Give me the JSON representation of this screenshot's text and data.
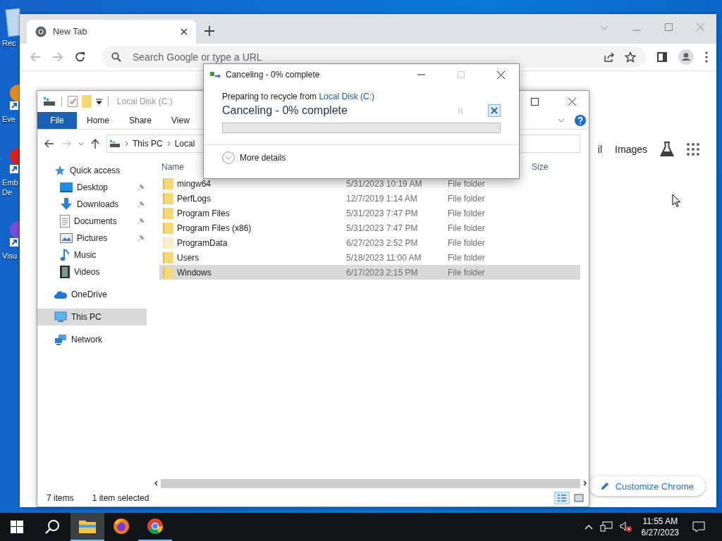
{
  "desktop_icons": [
    {
      "kind": "recycle",
      "lines": [
        "Rec"
      ]
    },
    {
      "kind": "shortcut",
      "lines": [
        "Eve"
      ]
    },
    {
      "kind": "shortcut",
      "lines": [
        "Emb",
        "De"
      ]
    },
    {
      "kind": "shortcut",
      "lines": [
        "Visu"
      ]
    }
  ],
  "browser": {
    "tabs": [
      {
        "title": "New Tab",
        "selected": true
      }
    ],
    "omnibox": {
      "placeholder": "Search Google or type a URL"
    },
    "links": [
      "il",
      "Images"
    ],
    "customize_button": "Customize Chrome"
  },
  "explorer": {
    "title": "Local Disk (C:)",
    "ribbon_tabs": [
      {
        "label": "File",
        "kind": "file"
      },
      {
        "label": "Home",
        "kind": "tab"
      },
      {
        "label": "Share",
        "kind": "tab"
      },
      {
        "label": "View",
        "kind": "tab"
      }
    ],
    "breadcrumb": [
      "This PC",
      "Local"
    ],
    "nav": [
      {
        "label": "Quick access",
        "kind": "star",
        "selected": false,
        "children": [
          {
            "label": "Desktop",
            "kind": "desktop",
            "selected": false,
            "pinned": true
          },
          {
            "label": "Downloads",
            "kind": "downloads",
            "selected": false,
            "pinned": true
          },
          {
            "label": "Documents",
            "kind": "documents",
            "selected": false,
            "pinned": true
          },
          {
            "label": "Pictures",
            "kind": "pictures",
            "selected": false,
            "pinned": true
          },
          {
            "label": "Music",
            "kind": "music",
            "selected": false,
            "pinned": false
          },
          {
            "label": "Videos",
            "kind": "videos",
            "selected": false,
            "pinned": false
          }
        ]
      },
      {
        "label": "OneDrive",
        "kind": "cloud",
        "selected": false
      },
      {
        "label": "This PC",
        "kind": "pc",
        "selected": true
      },
      {
        "label": "Network",
        "kind": "network",
        "selected": false
      }
    ],
    "columns": [
      "Name",
      "Size"
    ],
    "rows": [
      {
        "name": "mingw64",
        "modified": "5/31/2023 10:19 AM",
        "type": "File folder",
        "hidden": false,
        "selected": false
      },
      {
        "name": "PerfLogs",
        "modified": "12/7/2019 1:14 AM",
        "type": "File folder",
        "hidden": false,
        "selected": false
      },
      {
        "name": "Program Files",
        "modified": "5/31/2023 7:47 PM",
        "type": "File folder",
        "hidden": false,
        "selected": false
      },
      {
        "name": "Program Files (x86)",
        "modified": "5/31/2023 7:47 PM",
        "type": "File folder",
        "hidden": false,
        "selected": false
      },
      {
        "name": "ProgramData",
        "modified": "6/27/2023 2:52 PM",
        "type": "File folder",
        "hidden": true,
        "selected": false
      },
      {
        "name": "Users",
        "modified": "5/18/2023 11:00 AM",
        "type": "File folder",
        "hidden": false,
        "selected": false
      },
      {
        "name": "Windows",
        "modified": "6/17/2023 2:15 PM",
        "type": "File folder",
        "hidden": false,
        "selected": true
      }
    ],
    "status_bar": {
      "count": "7 items",
      "selection": "1 item selected"
    }
  },
  "dialog": {
    "title": "Canceling - 0% complete",
    "message": "Preparing to recycle from",
    "source": "Local Disk (C:)",
    "status": "Canceling - 0% complete",
    "progress": {
      "level": 0
    },
    "details": "More details"
  },
  "taskbar": {
    "apps": [
      {
        "kind": "explorer",
        "focused": true,
        "running": true
      },
      {
        "kind": "firefox",
        "focused": false,
        "running": false
      },
      {
        "kind": "chrome",
        "focused": false,
        "running": true
      }
    ],
    "time": "11:55 AM",
    "date": "6/27/2023"
  }
}
